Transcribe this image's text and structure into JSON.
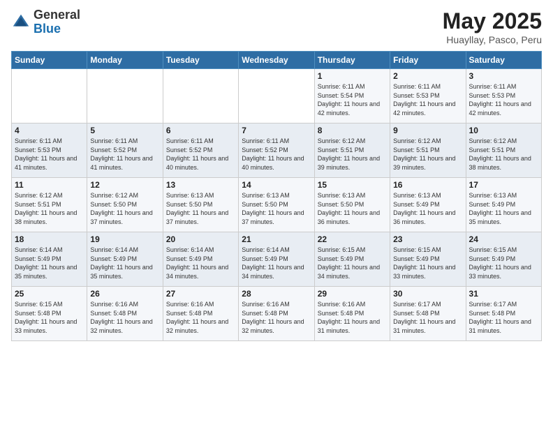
{
  "logo": {
    "general": "General",
    "blue": "Blue"
  },
  "title": {
    "month": "May 2025",
    "location": "Huayllay, Pasco, Peru"
  },
  "weekdays": [
    "Sunday",
    "Monday",
    "Tuesday",
    "Wednesday",
    "Thursday",
    "Friday",
    "Saturday"
  ],
  "weeks": [
    [
      {
        "day": "",
        "info": ""
      },
      {
        "day": "",
        "info": ""
      },
      {
        "day": "",
        "info": ""
      },
      {
        "day": "",
        "info": ""
      },
      {
        "day": "1",
        "info": "Sunrise: 6:11 AM\nSunset: 5:54 PM\nDaylight: 11 hours\nand 42 minutes."
      },
      {
        "day": "2",
        "info": "Sunrise: 6:11 AM\nSunset: 5:53 PM\nDaylight: 11 hours\nand 42 minutes."
      },
      {
        "day": "3",
        "info": "Sunrise: 6:11 AM\nSunset: 5:53 PM\nDaylight: 11 hours\nand 42 minutes."
      }
    ],
    [
      {
        "day": "4",
        "info": "Sunrise: 6:11 AM\nSunset: 5:53 PM\nDaylight: 11 hours\nand 41 minutes."
      },
      {
        "day": "5",
        "info": "Sunrise: 6:11 AM\nSunset: 5:52 PM\nDaylight: 11 hours\nand 41 minutes."
      },
      {
        "day": "6",
        "info": "Sunrise: 6:11 AM\nSunset: 5:52 PM\nDaylight: 11 hours\nand 40 minutes."
      },
      {
        "day": "7",
        "info": "Sunrise: 6:11 AM\nSunset: 5:52 PM\nDaylight: 11 hours\nand 40 minutes."
      },
      {
        "day": "8",
        "info": "Sunrise: 6:12 AM\nSunset: 5:51 PM\nDaylight: 11 hours\nand 39 minutes."
      },
      {
        "day": "9",
        "info": "Sunrise: 6:12 AM\nSunset: 5:51 PM\nDaylight: 11 hours\nand 39 minutes."
      },
      {
        "day": "10",
        "info": "Sunrise: 6:12 AM\nSunset: 5:51 PM\nDaylight: 11 hours\nand 38 minutes."
      }
    ],
    [
      {
        "day": "11",
        "info": "Sunrise: 6:12 AM\nSunset: 5:51 PM\nDaylight: 11 hours\nand 38 minutes."
      },
      {
        "day": "12",
        "info": "Sunrise: 6:12 AM\nSunset: 5:50 PM\nDaylight: 11 hours\nand 37 minutes."
      },
      {
        "day": "13",
        "info": "Sunrise: 6:13 AM\nSunset: 5:50 PM\nDaylight: 11 hours\nand 37 minutes."
      },
      {
        "day": "14",
        "info": "Sunrise: 6:13 AM\nSunset: 5:50 PM\nDaylight: 11 hours\nand 37 minutes."
      },
      {
        "day": "15",
        "info": "Sunrise: 6:13 AM\nSunset: 5:50 PM\nDaylight: 11 hours\nand 36 minutes."
      },
      {
        "day": "16",
        "info": "Sunrise: 6:13 AM\nSunset: 5:49 PM\nDaylight: 11 hours\nand 36 minutes."
      },
      {
        "day": "17",
        "info": "Sunrise: 6:13 AM\nSunset: 5:49 PM\nDaylight: 11 hours\nand 35 minutes."
      }
    ],
    [
      {
        "day": "18",
        "info": "Sunrise: 6:14 AM\nSunset: 5:49 PM\nDaylight: 11 hours\nand 35 minutes."
      },
      {
        "day": "19",
        "info": "Sunrise: 6:14 AM\nSunset: 5:49 PM\nDaylight: 11 hours\nand 35 minutes."
      },
      {
        "day": "20",
        "info": "Sunrise: 6:14 AM\nSunset: 5:49 PM\nDaylight: 11 hours\nand 34 minutes."
      },
      {
        "day": "21",
        "info": "Sunrise: 6:14 AM\nSunset: 5:49 PM\nDaylight: 11 hours\nand 34 minutes."
      },
      {
        "day": "22",
        "info": "Sunrise: 6:15 AM\nSunset: 5:49 PM\nDaylight: 11 hours\nand 34 minutes."
      },
      {
        "day": "23",
        "info": "Sunrise: 6:15 AM\nSunset: 5:49 PM\nDaylight: 11 hours\nand 33 minutes."
      },
      {
        "day": "24",
        "info": "Sunrise: 6:15 AM\nSunset: 5:49 PM\nDaylight: 11 hours\nand 33 minutes."
      }
    ],
    [
      {
        "day": "25",
        "info": "Sunrise: 6:15 AM\nSunset: 5:48 PM\nDaylight: 11 hours\nand 33 minutes."
      },
      {
        "day": "26",
        "info": "Sunrise: 6:16 AM\nSunset: 5:48 PM\nDaylight: 11 hours\nand 32 minutes."
      },
      {
        "day": "27",
        "info": "Sunrise: 6:16 AM\nSunset: 5:48 PM\nDaylight: 11 hours\nand 32 minutes."
      },
      {
        "day": "28",
        "info": "Sunrise: 6:16 AM\nSunset: 5:48 PM\nDaylight: 11 hours\nand 32 minutes."
      },
      {
        "day": "29",
        "info": "Sunrise: 6:16 AM\nSunset: 5:48 PM\nDaylight: 11 hours\nand 31 minutes."
      },
      {
        "day": "30",
        "info": "Sunrise: 6:17 AM\nSunset: 5:48 PM\nDaylight: 11 hours\nand 31 minutes."
      },
      {
        "day": "31",
        "info": "Sunrise: 6:17 AM\nSunset: 5:48 PM\nDaylight: 11 hours\nand 31 minutes."
      }
    ]
  ]
}
